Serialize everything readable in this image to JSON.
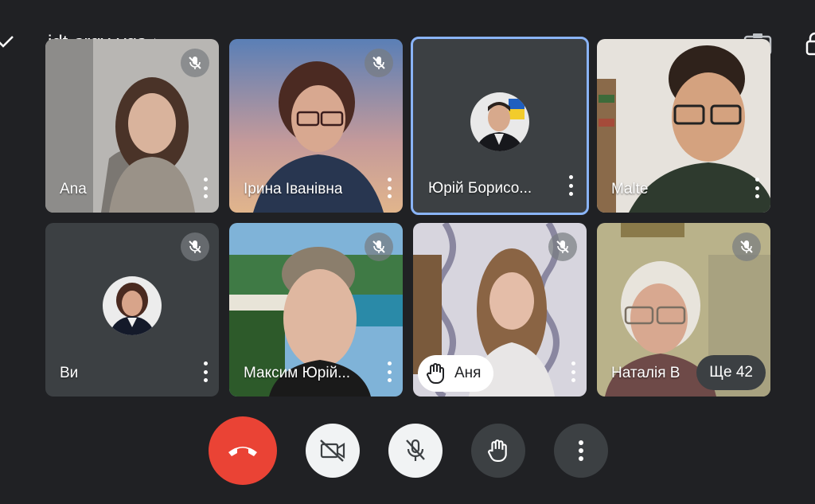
{
  "meeting": {
    "code": "idt-srgy-vqs"
  },
  "tiles": [
    {
      "name": "Ana",
      "muted": true
    },
    {
      "name": "Ірина Іванівна",
      "muted": true
    },
    {
      "name": "Юрій Борисо...",
      "muted": false
    },
    {
      "name": "Malte",
      "muted": false
    },
    {
      "name": "Ви",
      "muted": true
    },
    {
      "name": "Максим Юрій...",
      "muted": true
    },
    {
      "name": "Аня",
      "muted": true
    },
    {
      "name": "Наталія В",
      "muted": true
    }
  ],
  "overflow": {
    "label": "Ще 42"
  },
  "controls": [
    {
      "id": "end-call",
      "icon": "phone-hangup-icon"
    },
    {
      "id": "camera",
      "icon": "video-off-icon"
    },
    {
      "id": "microphone",
      "icon": "mic-off-icon"
    },
    {
      "id": "raise-hand",
      "icon": "hand-icon"
    },
    {
      "id": "more-options",
      "icon": "more-vert-icon"
    }
  ],
  "colors": {
    "background": "#202124",
    "end_call": "#ea4335",
    "active_border": "#8ab4f8"
  }
}
